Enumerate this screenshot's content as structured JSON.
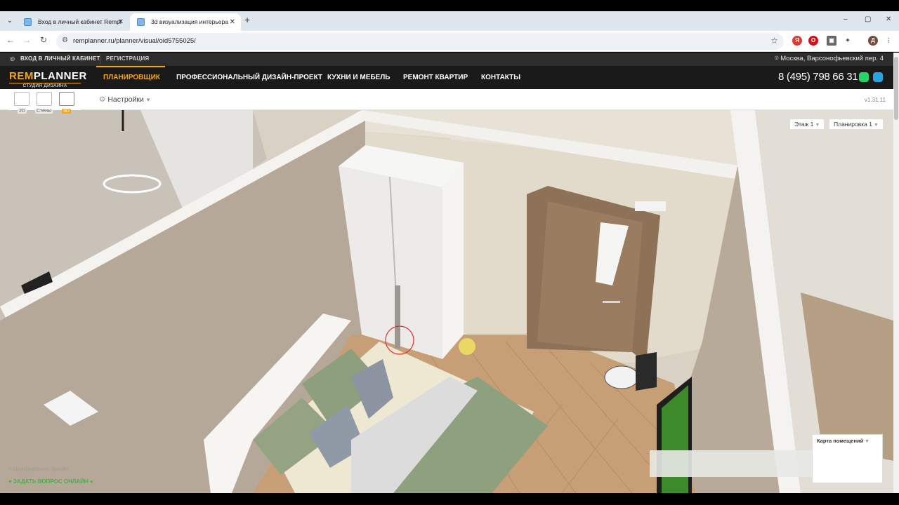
{
  "browser": {
    "tabs": [
      {
        "title": "Вход в личный кабинет Rempl",
        "active": false
      },
      {
        "title": "3d визуализация интерьера",
        "active": true
      }
    ],
    "url": "remplanner.ru/planner/visual/oid5755025/",
    "profile_initial": "Д",
    "new_tab": "+",
    "controls": {
      "minimize": "–",
      "maximize": "▢",
      "close": "✕"
    }
  },
  "site": {
    "topbar": {
      "login": "ВХОД В ЛИЧНЫЙ КАБИНЕТ",
      "register": "РЕГИСТРАЦИЯ",
      "address": "Москва, Варсонофьевский пер. 4"
    },
    "logo": {
      "brand_a": "REM",
      "brand_b": "PLANNER",
      "tagline": "СТУДИЯ ДИЗАЙНА"
    },
    "nav": [
      "ПЛАНИРОВЩИК",
      "ПРОФЕССИОНАЛЬНЫЙ ДИЗАЙН-ПРОЕКТ",
      "КУХНИ И МЕБЕЛЬ",
      "РЕМОНТ КВАРТИР",
      "КОНТАКТЫ"
    ],
    "phone": "8 (495) 798 66 31",
    "colors": {
      "accent": "#f2a516",
      "header_bg": "#1a1a1a",
      "topbar_bg": "#2d2d2d"
    }
  },
  "planner": {
    "view_modes": [
      "2D",
      "Стены",
      "3D"
    ],
    "active_view": "3D",
    "settings_label": "Настройки",
    "version": "v1.31.11",
    "floor_select": "Этаж 1",
    "layout_select": "Планировка 1",
    "room_map_label": "Карта помещений",
    "center_project": "Центрировать проект",
    "ask_online": "ЗАДАТЬ ВОПРОС ОНЛАЙН"
  }
}
